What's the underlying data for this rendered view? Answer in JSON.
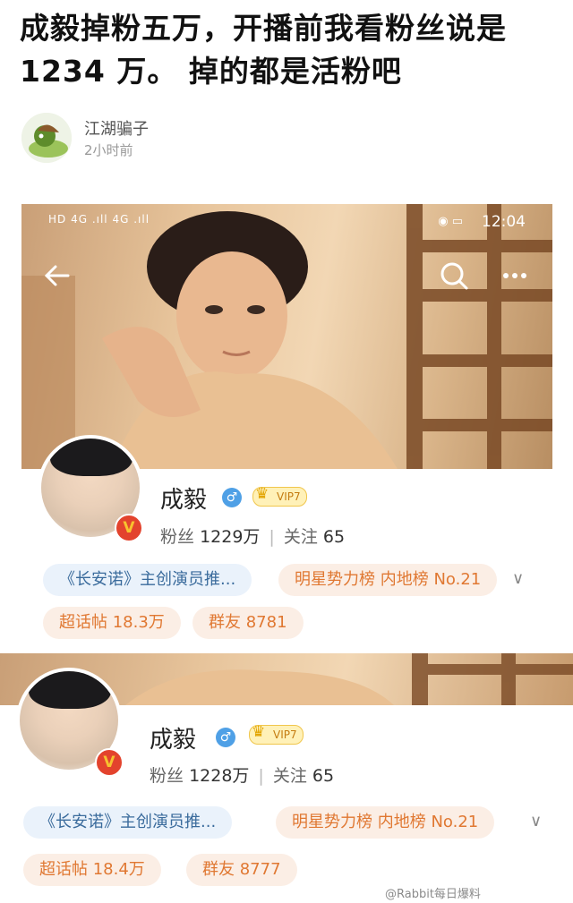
{
  "post": {
    "headline": "成毅掉粉五万，开播前我看粉丝说是1234 万。 掉的都是活粉吧",
    "author": "江湖骗子",
    "time": "2小时前"
  },
  "screenshot1": {
    "status": {
      "left": "HD 4G .ıll 4G .ıll",
      "time": "12:04"
    },
    "profile": {
      "name": "成毅",
      "vip": "VIP7",
      "fans_label": "粉丝",
      "fans": "1229万",
      "follow_label": "关注",
      "follow": "65"
    },
    "tags": {
      "show": "《长安诺》主创演员推...",
      "rank": "明星势力榜 内地榜 No.21",
      "supertopic": "超话帖 18.3万",
      "group": "群友 8781"
    }
  },
  "screenshot2": {
    "profile": {
      "name": "成毅",
      "vip": "VIP7",
      "fans_label": "粉丝",
      "fans": "1228万",
      "follow_label": "关注",
      "follow": "65"
    },
    "tags": {
      "show": "《长安诺》主创演员推...",
      "rank": "明星势力榜 内地榜 No.21",
      "supertopic": "超话帖 18.4万",
      "group": "群友 8777"
    }
  },
  "watermark": "@Rabbit每日爆料",
  "icons": {
    "back": "back-arrow-icon",
    "search": "search-icon",
    "more": "more-icon",
    "male": "male-icon",
    "verified": "verified-v-icon",
    "chevron": "chevron-down-icon"
  },
  "colors": {
    "pill_blue_text": "#3a6b9c",
    "pill_orange_text": "#e07832",
    "verified": "#e3432d",
    "male": "#4fa0e6"
  }
}
